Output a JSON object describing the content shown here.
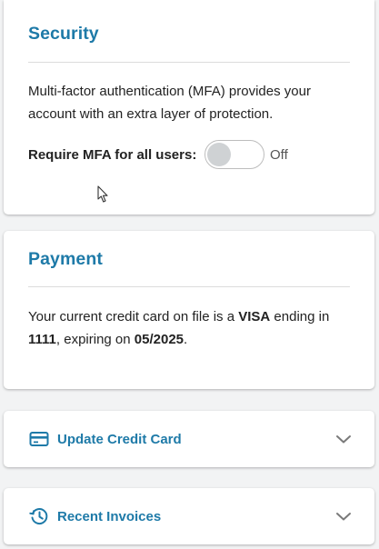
{
  "security": {
    "title": "Security",
    "description": "Multi-factor authentication (MFA) provides your account with an extra layer of protection.",
    "mfa_label": "Require MFA for all users:",
    "mfa_enabled": false,
    "mfa_state_label": "Off"
  },
  "payment": {
    "title": "Payment",
    "text_prefix": "Your current credit card on file is a ",
    "card_brand": "VISA",
    "text_middle": " ending in ",
    "card_last4": "1111",
    "text_expiry": ", expiring on ",
    "expiry": "05/2025",
    "text_end": "."
  },
  "accordions": [
    {
      "label": "Update Credit Card",
      "icon": "credit-card-icon",
      "expanded": false
    },
    {
      "label": "Recent Invoices",
      "icon": "history-icon",
      "expanded": false
    }
  ],
  "colors": {
    "accent": "#1e7aa8",
    "background": "#f2f3f4",
    "toggle_off_knob": "#cfd2d4"
  }
}
